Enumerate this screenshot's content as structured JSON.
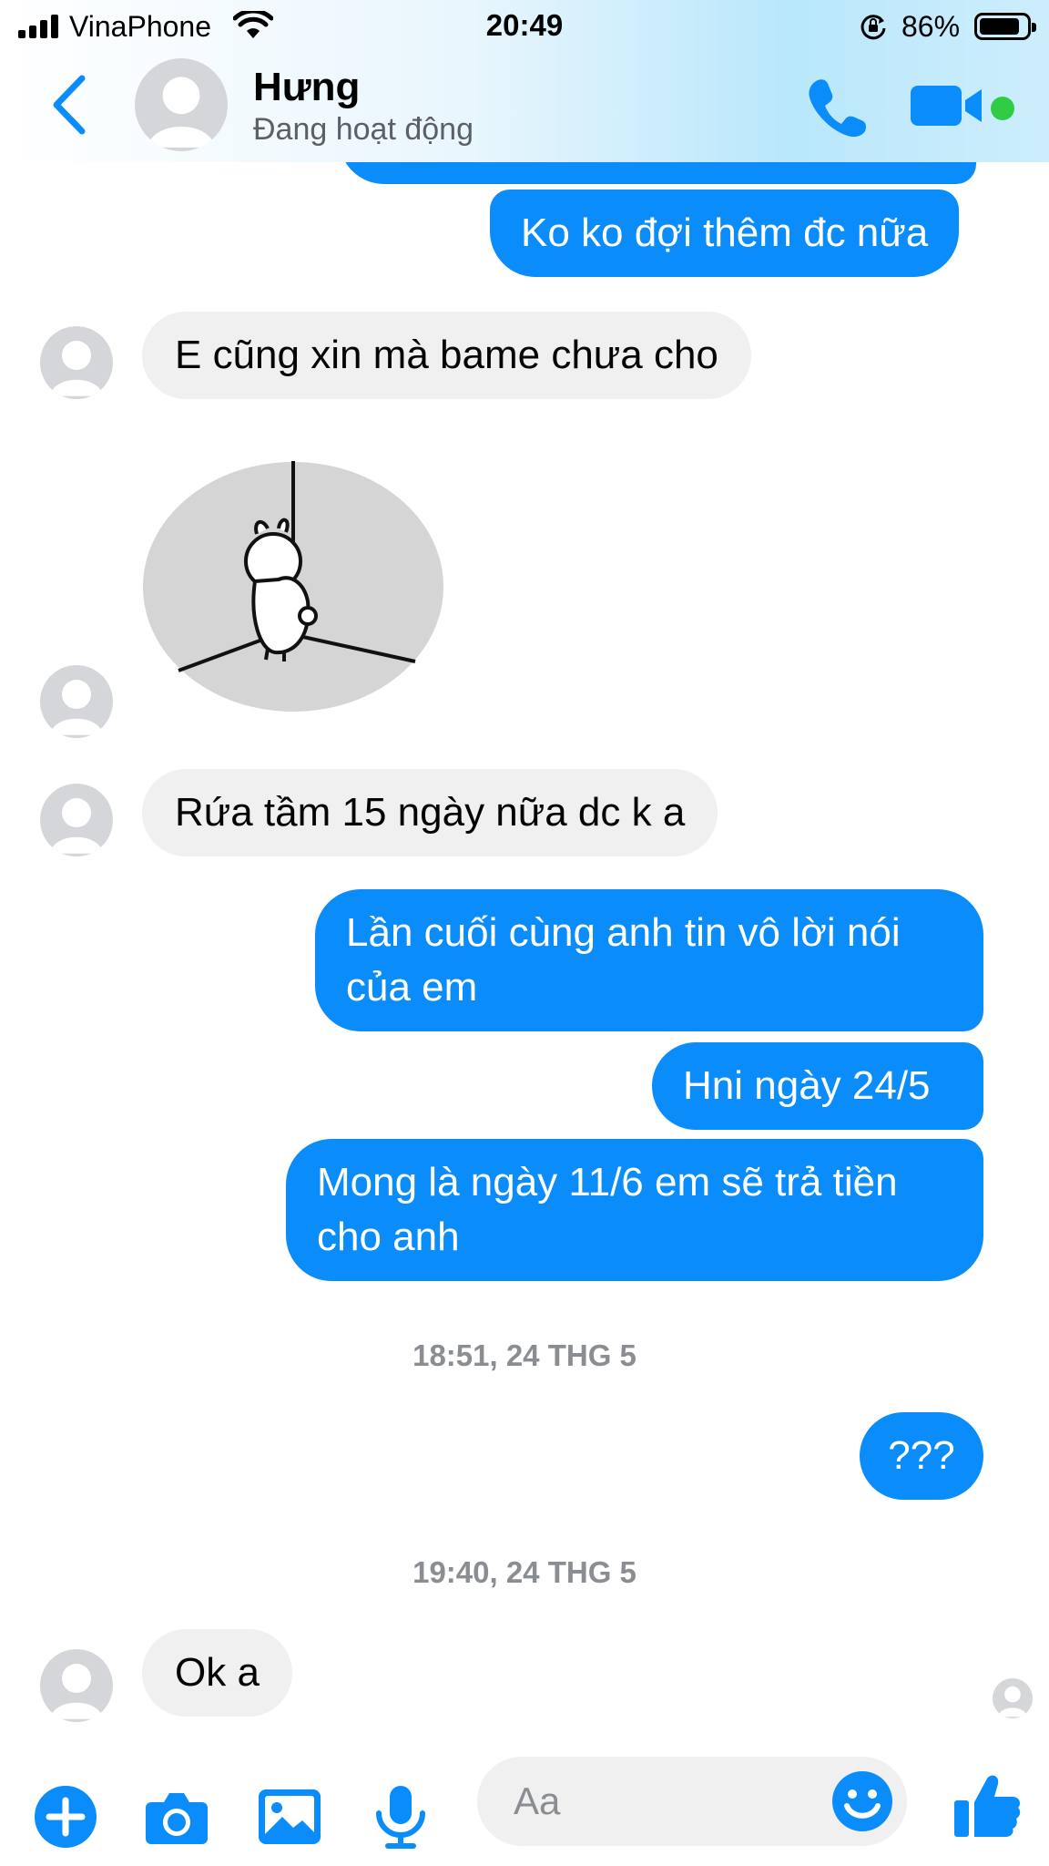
{
  "status_bar": {
    "carrier": "VinaPhone",
    "time": "20:49",
    "battery_percent": "86%",
    "battery_level": 0.86,
    "icons": [
      "signal-icon",
      "wifi-icon",
      "orientation-lock-icon",
      "battery-icon"
    ]
  },
  "header": {
    "contact_name": "Hưng",
    "contact_status": "Đang hoạt động",
    "icons": [
      "back-chevron-icon",
      "avatar-placeholder-icon",
      "phone-icon",
      "video-camera-icon"
    ],
    "online_color": "#31cc46"
  },
  "messages": {
    "m1": "Ko ko đợi thêm đc nữa",
    "m2": "E cũng xin mà bame chưa cho",
    "m3": "Rứa tầm 15 ngày nữa dc k a",
    "m4_line1": "Lần cuối cùng anh tin vô lời nói",
    "m4_line2": "của em",
    "m5": "Hni ngày 24/5",
    "m6_line1": "Mong là ngày 11/6 em sẽ trả tiền",
    "m6_line2": "cho anh",
    "ts1": "18:51, 24 THG 5",
    "m7": "???",
    "ts2": "19:40, 24 THG 5",
    "m8": "Ok a",
    "sticker": "bunny-hanging-sticker"
  },
  "composer": {
    "placeholder": "Aa",
    "icons": [
      "plus-icon",
      "camera-icon",
      "image-icon",
      "microphone-icon",
      "emoji-icon",
      "thumbs-up-icon"
    ]
  },
  "colors": {
    "outgoing_bubble": "#0a8cfb",
    "incoming_bubble": "#f0f0f1",
    "accent": "#0a8cfb",
    "timestamp": "#8a8d91"
  }
}
